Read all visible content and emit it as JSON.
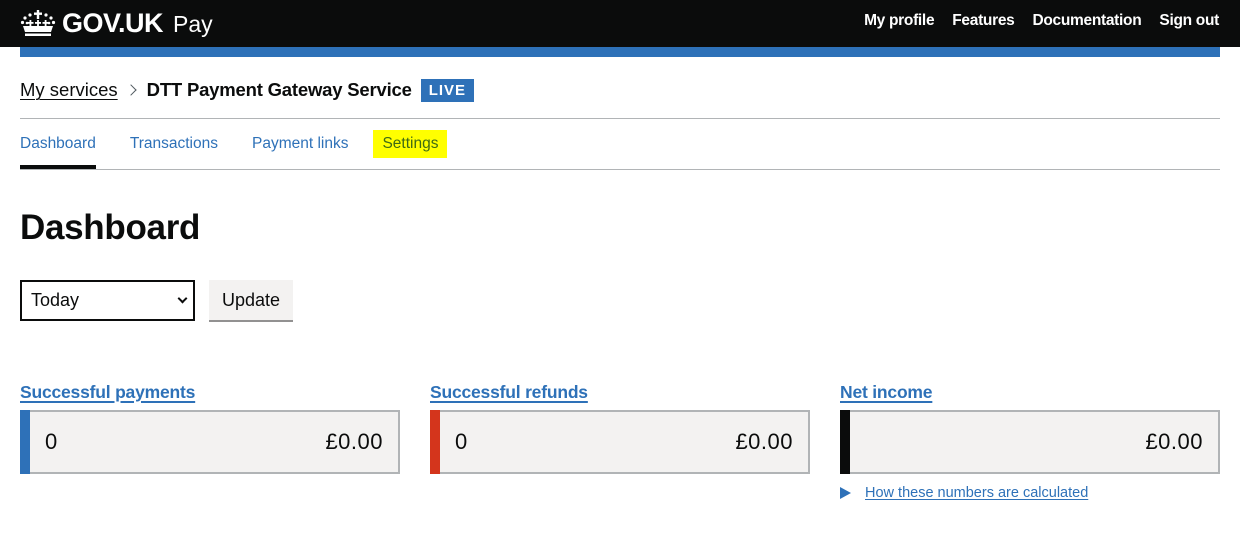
{
  "header": {
    "logo_text": "GOV.UK",
    "product_name": "Pay",
    "logo_icon": "crown-icon",
    "nav": [
      {
        "label": "My profile"
      },
      {
        "label": "Features"
      },
      {
        "label": "Documentation"
      },
      {
        "label": "Sign out"
      }
    ],
    "accent_color": "#2e71b8"
  },
  "breadcrumb": {
    "parent_label": "My services",
    "separator_icon": "chevron-right-icon",
    "service_name": "DTT Payment Gateway Service",
    "status_tag": "LIVE"
  },
  "subnav": {
    "tabs": [
      {
        "label": "Dashboard",
        "active": true
      },
      {
        "label": "Transactions",
        "active": false
      },
      {
        "label": "Payment links",
        "active": false
      },
      {
        "label": "Settings",
        "active": false,
        "highlighted": true
      }
    ]
  },
  "main": {
    "title": "Dashboard",
    "period_select": {
      "selected": "Today"
    },
    "update_button": "Update",
    "cards": [
      {
        "title": "Successful payments",
        "count": "0",
        "amount": "£0.00",
        "color": "#2e71b8"
      },
      {
        "title": "Successful refunds",
        "count": "0",
        "amount": "£0.00",
        "color": "#d4351c"
      },
      {
        "title": "Net income",
        "count": "",
        "amount": "£0.00",
        "color": "#0b0c0c"
      }
    ],
    "details_link": "How these numbers are calculated"
  }
}
